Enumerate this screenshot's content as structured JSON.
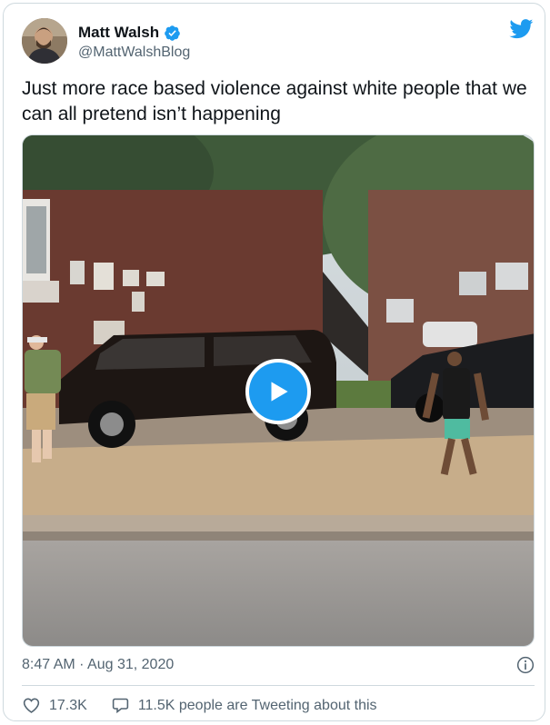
{
  "author": {
    "name": "Matt Walsh",
    "handle": "@MattWalshBlog",
    "verified": true
  },
  "tweet": {
    "text": "Just more race based violence against white people that we can all pretend isn’t happening",
    "timestamp": "8:47 AM · Aug 31, 2020"
  },
  "media": {
    "type": "video",
    "play_icon": "play-icon"
  },
  "stats": {
    "likes": "17.3K",
    "tweeting": "11.5K people are Tweeting about this"
  },
  "icons": {
    "brand": "twitter-bird-icon",
    "verified": "verified-badge-icon",
    "info": "info-icon",
    "like": "heart-icon",
    "reply": "speech-bubble-icon"
  },
  "colors": {
    "accent": "#1d9bf0",
    "text": "#0f1419",
    "muted": "#536471",
    "border": "#cfd9de"
  }
}
